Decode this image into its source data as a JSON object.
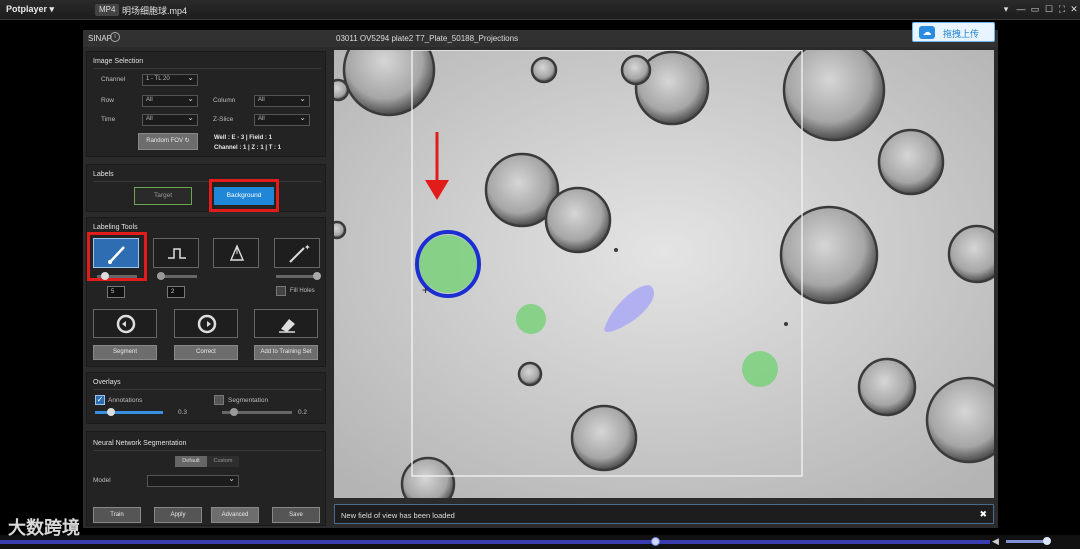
{
  "player": {
    "brand": "Potplayer ▾",
    "format_badge": "MP4",
    "file_name": "明场细胞球.mp4"
  },
  "app": {
    "name": "SINAP",
    "file_title": "03011 OV5294 plate2 T7_Plate_50188_Projections"
  },
  "upload": {
    "label": "拖拽上传"
  },
  "image_selection": {
    "title": "Image Selection",
    "channel_label": "Channel",
    "channel_value": "1 - TL 20",
    "row_label": "Row",
    "row_value": "All",
    "column_label": "Column",
    "column_value": "All",
    "time_label": "Time",
    "time_value": "All",
    "zslice_label": "Z-Slice",
    "zslice_value": "All",
    "random_fov": "Random FOV",
    "well_info": "Well : E - 3 |  Field : 1",
    "channel_info": "Channel : 1 | Z : 1  | T : 1"
  },
  "labels": {
    "title": "Labels",
    "target": "Target",
    "background": "Background"
  },
  "labeling_tools": {
    "title": "Labeling Tools",
    "brush_size": "5",
    "erase_size": "2",
    "fill_holes": "Fill Holes",
    "segment": "Segment",
    "correct": "Correct",
    "add_to_training": "Add to Training Set"
  },
  "overlays": {
    "title": "Overlays",
    "annotations_label": "Annotations",
    "annotations_value": "0.3",
    "annotations_level": 0.3,
    "segmentation_label": "Segmentation",
    "segmentation_value": "0.2",
    "segmentation_level": 0.2
  },
  "nn": {
    "title": "Neural Network Segmentation",
    "tab_default": "Default",
    "tab_custom": "Custom",
    "model_label": "Model",
    "train": "Train",
    "apply": "Apply",
    "advanced": "Advanced",
    "save": "Save"
  },
  "status": {
    "message": "New field of view has been loaded",
    "close": "✖"
  },
  "watermark": "大数跨境",
  "colors": {
    "accent_blue": "#1f86d8",
    "annotation_red": "#e21b1b",
    "target_green": "#7fd07f",
    "outline_blue": "#1a2fd0"
  }
}
